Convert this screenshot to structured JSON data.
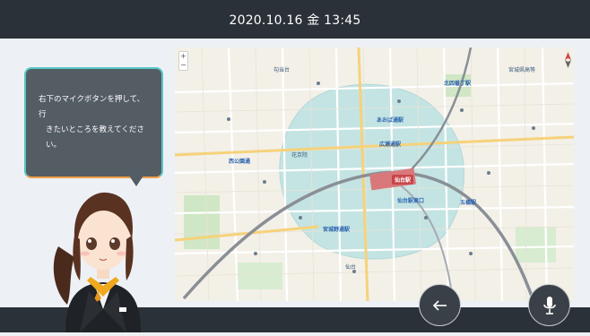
{
  "header": {
    "datetime": "2020.10.16 金 13:45"
  },
  "assistant": {
    "message_line1": "右下のマイクボタンを押して、行",
    "message_line2": "きたいところを教えてください。"
  },
  "map": {
    "labels": {
      "sendai_station_badge": "仙台駅",
      "aoba_dori": "あおば通駅",
      "hirose_dori": "広瀬通駅",
      "miyagino_dori": "宮城野通駅",
      "itsutsubashi": "五橋駅",
      "kitayobancho": "北四番丁駅",
      "nishikoen": "西公園通",
      "sendai_east": "仙台駅東口",
      "kotodai": "勾当台",
      "miyagi_highschool": "宮城県高等",
      "kakyoin": "花京院",
      "sendai": "仙台"
    }
  },
  "controls": {
    "zoom_in": "+",
    "zoom_out": "−",
    "back_icon": "arrow-left-icon",
    "mic_icon": "microphone-icon"
  },
  "colors": {
    "topbar": "#2b3138",
    "bubble_border_top": "#57c6c6",
    "bubble_border_bottom": "#f0a24a",
    "map_area_overlay": "#8fd3d8",
    "station": "#c8454a"
  }
}
